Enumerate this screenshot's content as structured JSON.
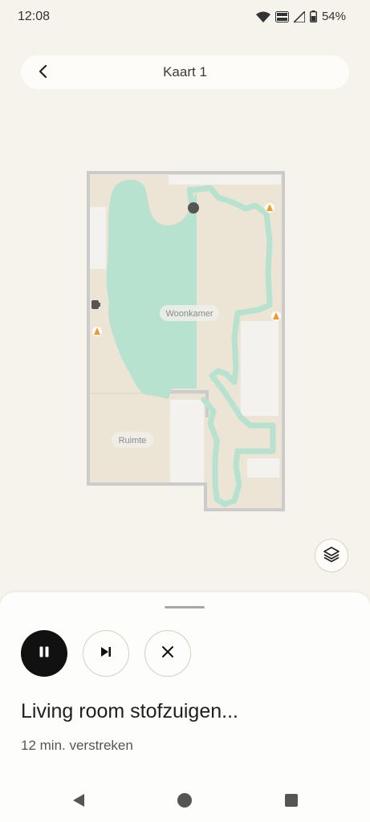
{
  "status_bar": {
    "time": "12:08",
    "battery_percent": "54%",
    "volte_badge": "VoWiFi"
  },
  "header": {
    "title": "Kaart 1",
    "back_icon": "chevron-left-icon"
  },
  "map": {
    "rooms": [
      {
        "label": "Woonkamer"
      },
      {
        "label": "Ruimte"
      }
    ],
    "colors": {
      "floor": "#ece4d4",
      "walls": "#cfcfcf",
      "cleaned_area": "#b6e2cf",
      "obstacle_marker": "#f39a2a",
      "robot": "#555555"
    }
  },
  "controls": {
    "layers_icon": "layers-icon",
    "pause_icon": "pause-icon",
    "skip_icon": "skip-next-icon",
    "stop_icon": "close-icon"
  },
  "task": {
    "title": "Living room stofzuigen...",
    "elapsed": "12 min. verstreken"
  },
  "nav": {
    "back_icon": "nav-back-icon",
    "home_icon": "nav-home-icon",
    "recents_icon": "nav-recents-icon"
  }
}
